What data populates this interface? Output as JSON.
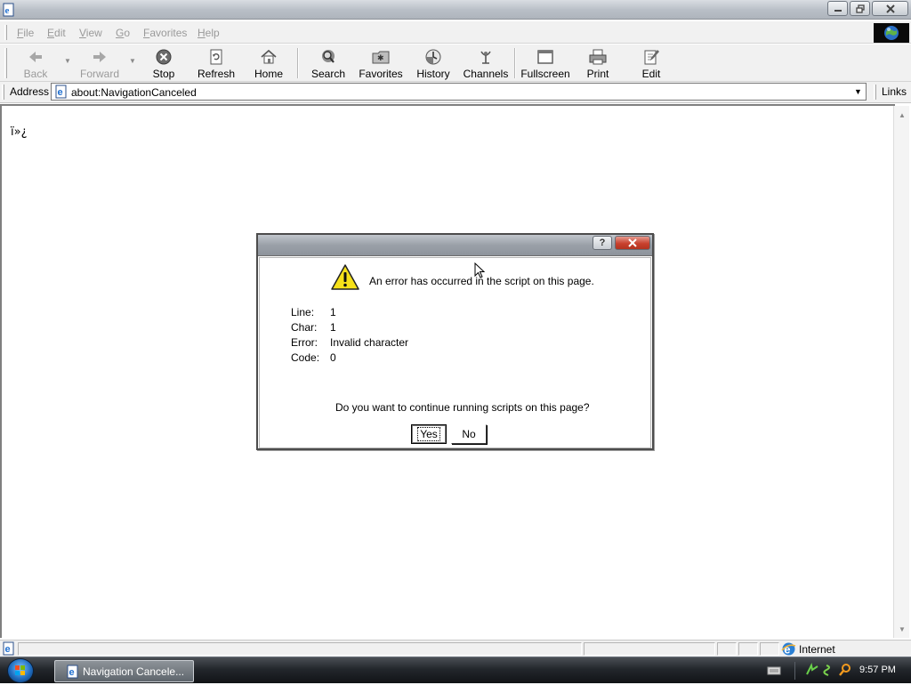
{
  "colors": {
    "content_bg": "#ffffff",
    "chrome_bg": "#f1f1f1",
    "taskbar_bg": "#23272c",
    "dialog_close_red": "#c8412e",
    "warning_yellow": "#f6e11a"
  },
  "titlebar": {
    "icon": "ie-page-icon",
    "buttons": [
      "minimize",
      "restore",
      "close"
    ]
  },
  "menu": {
    "items": [
      {
        "label": "File",
        "accel": "F",
        "rest": "ile"
      },
      {
        "label": "Edit",
        "accel": "E",
        "rest": "dit"
      },
      {
        "label": "View",
        "accel": "V",
        "rest": "iew"
      },
      {
        "label": "Go",
        "accel": "G",
        "rest": "o"
      },
      {
        "label": "Favorites",
        "accel": "F",
        "rest": "avorites"
      },
      {
        "label": "Help",
        "accel": "H",
        "rest": "elp"
      }
    ],
    "brand_icon": "ie-globe-logo"
  },
  "toolbar": {
    "back": {
      "label": "Back",
      "icon": "back-arrow-icon",
      "enabled": false
    },
    "forward": {
      "label": "Forward",
      "icon": "forward-arrow-icon",
      "enabled": false
    },
    "stop": {
      "label": "Stop",
      "icon": "stop-icon"
    },
    "refresh": {
      "label": "Refresh",
      "icon": "refresh-icon"
    },
    "home": {
      "label": "Home",
      "icon": "home-icon"
    },
    "search": {
      "label": "Search",
      "icon": "search-icon"
    },
    "favorites": {
      "label": "Favorites",
      "icon": "favorites-icon"
    },
    "history": {
      "label": "History",
      "icon": "history-icon"
    },
    "channels": {
      "label": "Channels",
      "icon": "channels-icon"
    },
    "fullscreen": {
      "label": "Fullscreen",
      "icon": "fullscreen-icon"
    },
    "print": {
      "label": "Print",
      "icon": "print-icon"
    },
    "edit": {
      "label": "Edit",
      "icon": "edit-icon"
    }
  },
  "addressbar": {
    "label": "Address",
    "url": "about:NavigationCanceled",
    "links_label": "Links"
  },
  "page": {
    "body_text": "ï»¿"
  },
  "dialog": {
    "message": "An error has occurred in the script on this page.",
    "details": [
      {
        "label": "Line:",
        "value": "1"
      },
      {
        "label": "Char:",
        "value": "1"
      },
      {
        "label": "Error:",
        "value": "Invalid character"
      },
      {
        "label": "Code:",
        "value": "0"
      }
    ],
    "question": "Do you want to continue running scripts on this page?",
    "yes_label": "Yes",
    "no_label": "No",
    "help_glyph": "?"
  },
  "statusbar": {
    "zone": "Internet"
  },
  "taskbar": {
    "task_label": "Navigation Cancele...",
    "clock": "9:57 PM"
  }
}
